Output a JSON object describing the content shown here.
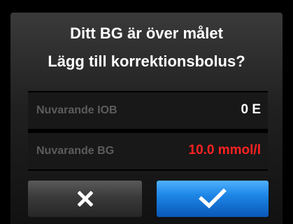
{
  "dialog": {
    "title_line1": "Ditt BG är över målet",
    "title_line2": "Lägg till korrektionsbolus?"
  },
  "info": {
    "rows": [
      {
        "label": "Nuvarande IOB",
        "value": "0 E"
      },
      {
        "label": "Nuvarande BG",
        "value": "10.0 mmol/l"
      }
    ],
    "bg_value_color": "#ff2222"
  },
  "buttons": {
    "cancel_icon": "x-icon",
    "confirm_icon": "checkmark-icon",
    "confirm_color": "#1d86e6"
  }
}
